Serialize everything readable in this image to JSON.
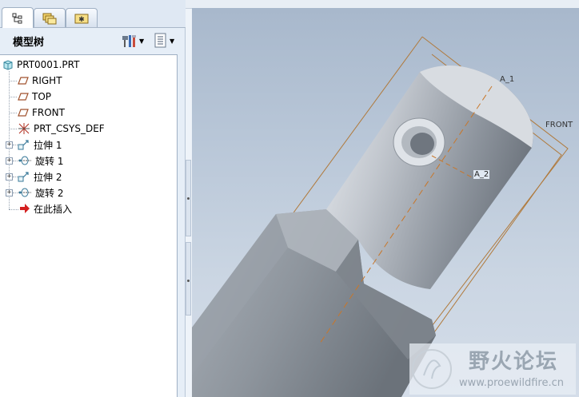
{
  "panel": {
    "title": "模型树"
  },
  "tree": {
    "root": "PRT0001.PRT",
    "items": [
      {
        "label": "RIGHT",
        "icon": "datum-plane-icon"
      },
      {
        "label": "TOP",
        "icon": "datum-plane-icon"
      },
      {
        "label": "FRONT",
        "icon": "datum-plane-icon"
      },
      {
        "label": "PRT_CSYS_DEF",
        "icon": "coordinate-system-icon"
      },
      {
        "label": "拉伸 1",
        "icon": "extrude-icon",
        "expandable": true
      },
      {
        "label": "旋转 1",
        "icon": "revolve-icon",
        "expandable": true
      },
      {
        "label": "拉伸 2",
        "icon": "extrude-icon",
        "expandable": true
      },
      {
        "label": "旋转 2",
        "icon": "revolve-icon",
        "expandable": true
      },
      {
        "label": "在此插入",
        "icon": "insert-arrow-icon"
      }
    ]
  },
  "viewport": {
    "labels": {
      "axis1": "A_1",
      "axis2": "A_2",
      "datum": "FRONT"
    }
  },
  "watermark": {
    "title": "野火论坛",
    "url": "www.proewildfire.cn"
  },
  "colors": {
    "accent": "#3b6ea8",
    "datum_line": "#b07a3c",
    "insert_arrow": "#d42020"
  }
}
